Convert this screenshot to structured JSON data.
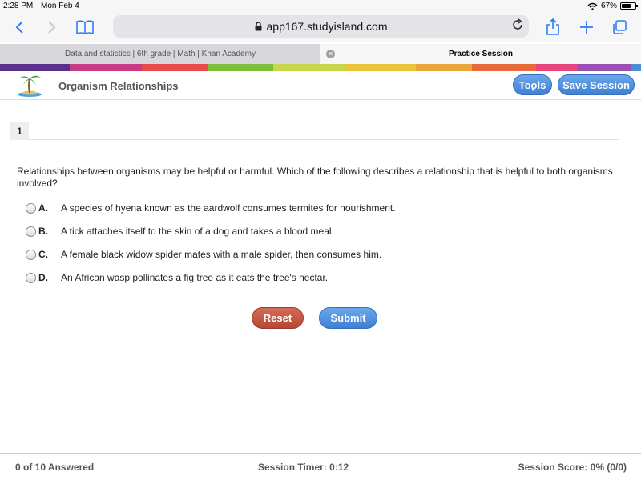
{
  "status": {
    "time": "2:28 PM",
    "date": "Mon Feb 4",
    "battery": "67%",
    "battery_level": 0.67
  },
  "browser": {
    "url": "app167.studyisland.com",
    "tabs": [
      {
        "label": "Data and statistics | 6th grade | Math | Khan Academy"
      },
      {
        "label": "Practice Session"
      }
    ],
    "icons": [
      "back-icon",
      "forward-icon",
      "bookmarks-icon",
      "lock-icon",
      "reload-icon",
      "share-icon",
      "new-tab-icon",
      "tabs-icon",
      "tab-close-icon",
      "wifi-icon",
      "battery-icon"
    ]
  },
  "rainbow_colors": [
    "#5b2f8c",
    "#c73a86",
    "#e64a4a",
    "#7bbf3a",
    "#c9d54a",
    "#e8c43a",
    "#e8a63a",
    "#e86a3a",
    "#e6447a",
    "#9b4fb0",
    "#4a8fd6"
  ],
  "app": {
    "lesson_title": "Organism Relationships",
    "tools_label": "Tools",
    "save_label": "Save Session",
    "accent": "#3f80d4"
  },
  "question": {
    "number": "1",
    "stem": "Relationships between organisms may be helpful or harmful. Which of the following describes a relationship that is helpful to both organisms involved?",
    "choices": [
      {
        "letter": "A.",
        "text": "A species of hyena known as the aardwolf consumes termites for nourishment."
      },
      {
        "letter": "B.",
        "text": "A tick attaches itself to the skin of a dog and takes a blood meal."
      },
      {
        "letter": "C.",
        "text": "A female black widow spider mates with a male spider, then consumes him."
      },
      {
        "letter": "D.",
        "text": "An African wasp pollinates a fig tree as it eats the tree's nectar."
      }
    ],
    "reset_label": "Reset",
    "submit_label": "Submit"
  },
  "footer": {
    "answered": "0 of 10 Answered",
    "timer": "Session Timer: 0:12",
    "score": "Session Score: 0% (0/0)"
  }
}
